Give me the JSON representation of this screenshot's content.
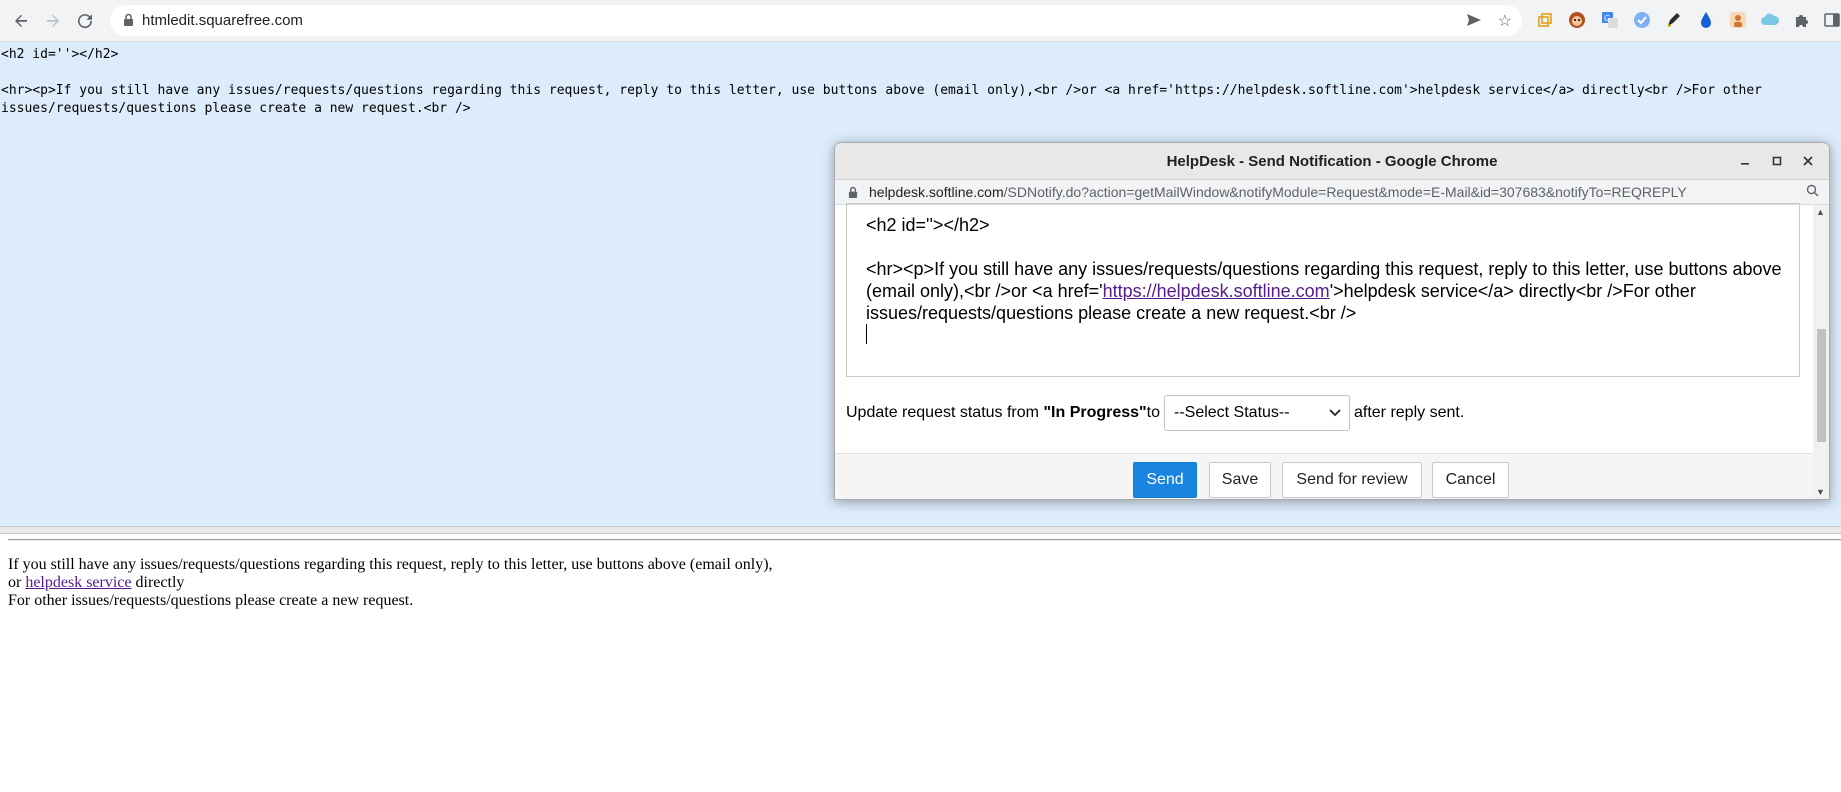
{
  "browser": {
    "url": "htmledit.squarefree.com"
  },
  "editor": {
    "source": "<h2 id=''></h2>\n\n<hr><p>If you still have any issues/requests/questions regarding this request, reply to this letter, use buttons above (email only),<br />or <a href='https://helpdesk.softline.com'>helpdesk service</a> directly<br />For other issues/requests/questions please create a new request.<br />"
  },
  "preview": {
    "line1": "If you still have any issues/requests/questions regarding this request, reply to this letter, use buttons above (email only),",
    "line2_prefix": "or ",
    "link_text": "helpdesk service",
    "line2_suffix": " directly",
    "line3": "For other issues/requests/questions please create a new request."
  },
  "popup": {
    "title": "HelpDesk - Send Notification - Google Chrome",
    "url_domain": "helpdesk.softline.com",
    "url_path": "/SDNotify.do?action=getMailWindow&notifyModule=Request&mode=E-Mail&id=307683&notifyTo=REQREPLY",
    "compose": {
      "line1": "<h2 id=''></h2>",
      "body_prefix": "<hr><p>If you still have any issues/requests/questions regarding this request, reply to this letter, use buttons above (email only),<br />or <a href='",
      "link": "https://helpdesk.softline.com",
      "body_suffix": "'>helpdesk service</a> directly<br />For other issues/requests/questions please create a new request.<br />"
    },
    "status": {
      "prefix": "Update request status from ",
      "current": "\"In Progress\"",
      "to": " to",
      "select_value": "--Select Status--",
      "suffix": "after reply sent."
    },
    "buttons": {
      "send": "Send",
      "save": "Save",
      "review": "Send for review",
      "cancel": "Cancel"
    }
  },
  "colors": {
    "editor_bg": "#dcecfb",
    "primary_button": "#1a85e0",
    "link": "#551a8b"
  }
}
